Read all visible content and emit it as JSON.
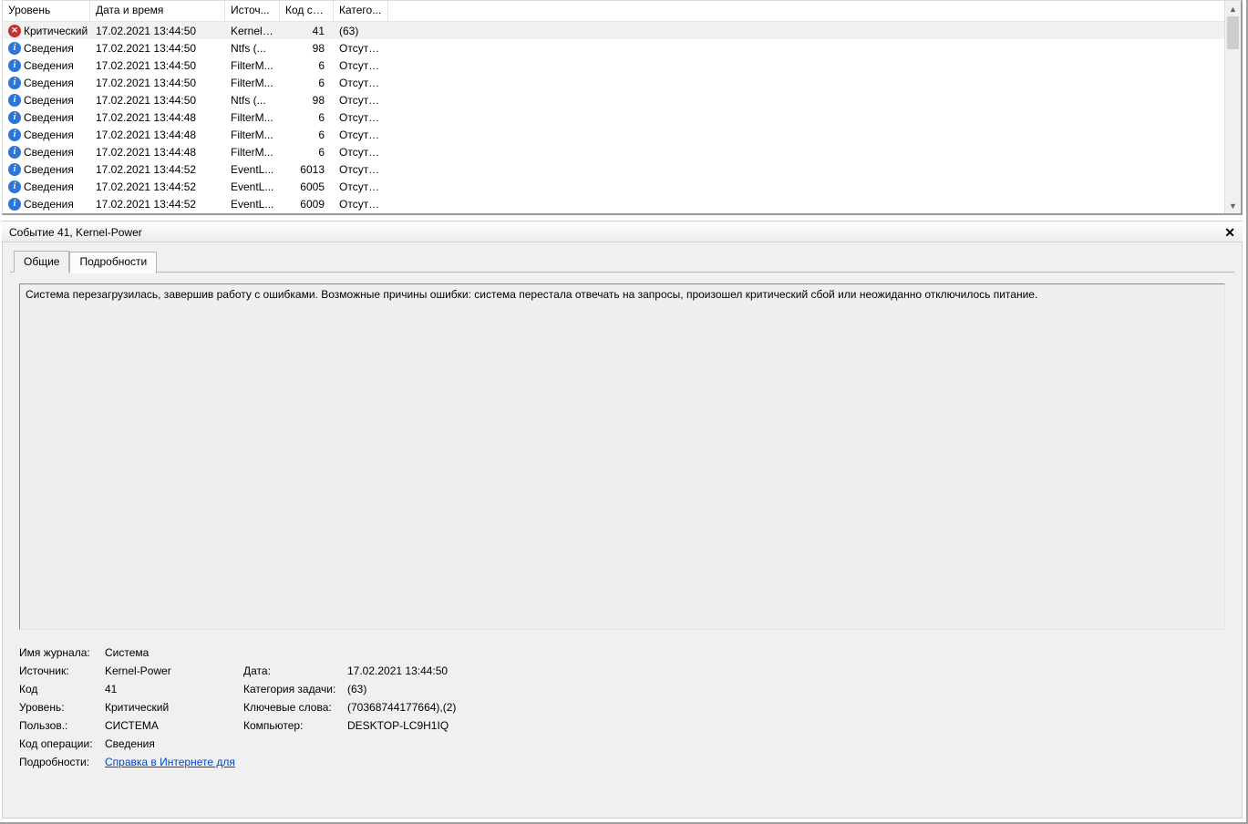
{
  "columns": {
    "level": "Уровень",
    "datetime": "Дата и время",
    "source": "Источ...",
    "code": "Код со...",
    "category": "Катего..."
  },
  "rows": [
    {
      "icon": "crit",
      "level": "Критический",
      "date": "17.02.2021 13:44:50",
      "src": "Kernel-...",
      "code": "41",
      "cat": "(63)",
      "selected": true
    },
    {
      "icon": "info",
      "level": "Сведения",
      "date": "17.02.2021 13:44:50",
      "src": "Ntfs (...",
      "code": "98",
      "cat": "Отсутс..."
    },
    {
      "icon": "info",
      "level": "Сведения",
      "date": "17.02.2021 13:44:50",
      "src": "FilterM...",
      "code": "6",
      "cat": "Отсутс..."
    },
    {
      "icon": "info",
      "level": "Сведения",
      "date": "17.02.2021 13:44:50",
      "src": "FilterM...",
      "code": "6",
      "cat": "Отсутс..."
    },
    {
      "icon": "info",
      "level": "Сведения",
      "date": "17.02.2021 13:44:50",
      "src": "Ntfs (...",
      "code": "98",
      "cat": "Отсутс..."
    },
    {
      "icon": "info",
      "level": "Сведения",
      "date": "17.02.2021 13:44:48",
      "src": "FilterM...",
      "code": "6",
      "cat": "Отсутс..."
    },
    {
      "icon": "info",
      "level": "Сведения",
      "date": "17.02.2021 13:44:48",
      "src": "FilterM...",
      "code": "6",
      "cat": "Отсутс..."
    },
    {
      "icon": "info",
      "level": "Сведения",
      "date": "17.02.2021 13:44:48",
      "src": "FilterM...",
      "code": "6",
      "cat": "Отсутс..."
    },
    {
      "icon": "info",
      "level": "Сведения",
      "date": "17.02.2021 13:44:52",
      "src": "EventL...",
      "code": "6013",
      "cat": "Отсутс..."
    },
    {
      "icon": "info",
      "level": "Сведения",
      "date": "17.02.2021 13:44:52",
      "src": "EventL...",
      "code": "6005",
      "cat": "Отсутс..."
    },
    {
      "icon": "info",
      "level": "Сведения",
      "date": "17.02.2021 13:44:52",
      "src": "EventL...",
      "code": "6009",
      "cat": "Отсутс..."
    }
  ],
  "detailHeader": "Событие 41, Kernel-Power",
  "tabs": {
    "general": "Общие",
    "details": "Подробности"
  },
  "message": "Система перезагрузилась, завершив работу с ошибками. Возможные причины ошибки: система перестала отвечать на запросы, произошел критический сбой или неожиданно отключилось питание.",
  "props": {
    "logNameLabel": "Имя журнала:",
    "logName": "Система",
    "sourceLabel": "Источник:",
    "source": "Kernel-Power",
    "dateLabel": "Дата:",
    "date": "17.02.2021 13:44:50",
    "codeLabel": "Код",
    "code": "41",
    "taskCatLabel": "Категория задачи:",
    "taskCat": "(63)",
    "levelLabel": "Уровень:",
    "level": "Критический",
    "keywordsLabel": "Ключевые слова:",
    "keywords": "(70368744177664),(2)",
    "userLabel": "Пользов.:",
    "user": "СИСТЕМА",
    "computerLabel": "Компьютер:",
    "computer": "DESKTOP-LC9H1IQ",
    "opcodeLabel": "Код операции:",
    "opcode": "Сведения",
    "moreLabel": "Подробности:",
    "moreLink": "Справка в Интернете для "
  }
}
